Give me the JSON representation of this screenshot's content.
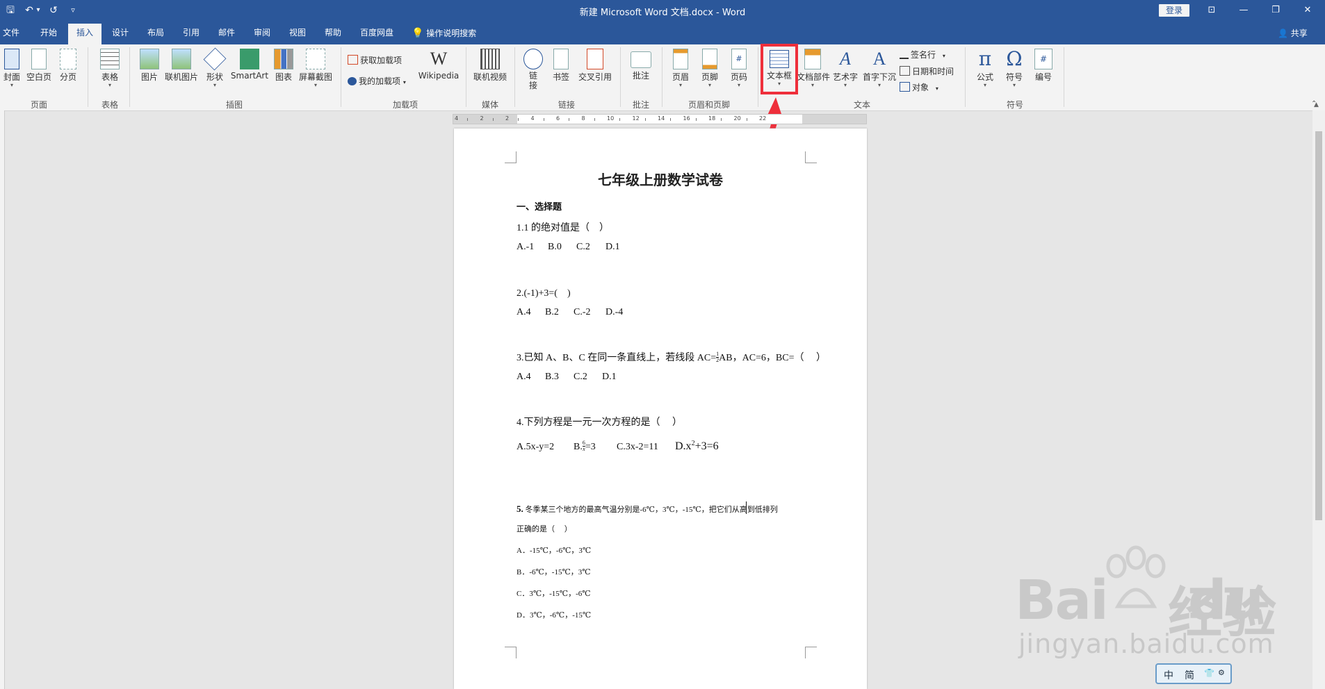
{
  "window": {
    "title": "新建 Microsoft Word 文档.docx  -  Word",
    "login": "登录",
    "quick_access": {
      "save": "🖫",
      "undo": "↶",
      "undo_drop": "▾",
      "redo": "↺",
      "customize": "▿"
    },
    "controls": {
      "ribbon_opts": "⊡",
      "minimize": "—",
      "restore": "❐",
      "close": "✕"
    }
  },
  "tabs": [
    "文件",
    "开始",
    "插入",
    "设计",
    "布局",
    "引用",
    "邮件",
    "审阅",
    "视图",
    "帮助",
    "百度网盘"
  ],
  "active_tab": "插入",
  "tell_me": "操作说明搜索",
  "share": "共享",
  "ribbon": {
    "groups": {
      "pages": "页面",
      "tables": "表格",
      "illustrations": "插图",
      "addins": "加载项",
      "media": "媒体",
      "links": "链接",
      "comments": "批注",
      "header_footer": "页眉和页脚",
      "text": "文本",
      "symbols": "符号"
    },
    "buttons": {
      "cover": "封面",
      "blank": "空白页",
      "pagebreak": "分页",
      "table": "表格",
      "picture": "图片",
      "online_picture": "联机图片",
      "shapes": "形状",
      "smartart": "SmartArt",
      "chart": "图表",
      "screenshot": "屏幕截图",
      "get_addins": "获取加载项",
      "my_addins": "我的加载项",
      "wikipedia": "Wikipedia",
      "online_video": "联机视频",
      "link": "链接",
      "bookmark": "书签",
      "crossref": "交叉引用",
      "comment": "批注",
      "header": "页眉",
      "footer": "页脚",
      "pagenum": "页码",
      "textbox": "文本框",
      "quickparts": "文档部件",
      "wordart": "艺术字",
      "dropcap": "首字下沉",
      "signature": "签名行",
      "datetime": "日期和时间",
      "object": "对象",
      "equation": "公式",
      "symbol": "符号",
      "number": "编号"
    }
  },
  "ruler": {
    "labels": [
      "4",
      "2",
      "2",
      "4",
      "6",
      "8",
      "10",
      "12",
      "14",
      "16",
      "18",
      "20",
      "22"
    ]
  },
  "document": {
    "heading": "七年级上册数学试卷",
    "section": "一、选择题",
    "q1": "1.1 的绝对值是（　）",
    "q1_opts": [
      "A.-1",
      "B.0",
      "C.2",
      "D.1"
    ],
    "q2": "2.(-1)+3=(　)",
    "q2_opts": [
      "A.4",
      "B.2",
      "C.-2",
      "D.-4"
    ],
    "q3_a": "3.已知 A、B、C 在同一条直线上，若线段 AC=",
    "q3_frac_num": "1",
    "q3_frac_den": "2",
    "q3_b": "AB，AC=6，BC=（　 ）",
    "q3_opts": [
      "A.4",
      "B.3",
      "C.2",
      "D.1"
    ],
    "q4": "4.下列方程是一元一次方程的是（　 ）",
    "q4_a": "A.5x-y=2",
    "q4_b_pre": "B.",
    "q4_b_num": "6",
    "q4_b_den": "x",
    "q4_b_post": "=3",
    "q4_c": "C.3x-2=11",
    "q4_d_pre": "D.x",
    "q4_d_sup": "2",
    "q4_d_post": "+3=6",
    "q5_num": "5.",
    "q5_text": "冬季某三个地方的最高气温分别是-6℃，3℃，-15℃，把它们从高到低排列",
    "q5_text2": "正确的是（　 ）",
    "q5_opts": [
      "A．-15℃，-6℃，3℃",
      "B．-6℃，-15℃，3℃",
      "C．3℃，-15℃，-6℃",
      "D．3℃，-6℃，-15℃"
    ]
  },
  "watermark": {
    "logo": "Bai",
    "logo2": "du",
    "cn": "经验",
    "url": "jingyan.baidu.com"
  },
  "ime": {
    "mode": "中",
    "charset": "简"
  },
  "colors": {
    "titlebar": "#2b579a",
    "highlight": "#ee2f3b"
  }
}
